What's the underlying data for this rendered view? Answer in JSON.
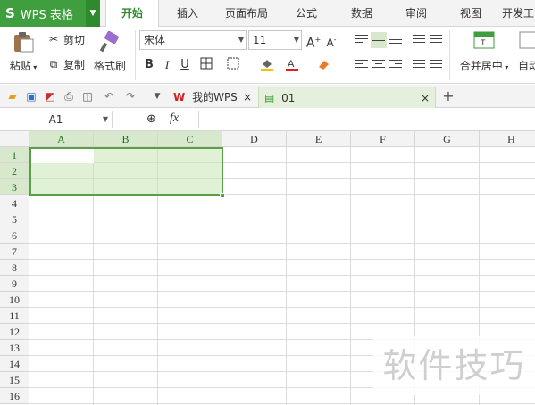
{
  "app": {
    "title": "WPS 表格",
    "logo": "S"
  },
  "menu_tabs": [
    "开始",
    "插入",
    "页面布局",
    "公式",
    "数据",
    "审阅",
    "视图",
    "开发工"
  ],
  "ribbon": {
    "paste_label": "粘贴",
    "cut_label": "剪切",
    "copy_label": "复制",
    "format_painter_label": "格式刷",
    "font_name": "宋体",
    "font_size": "11",
    "bold": "B",
    "italic": "I",
    "underline": "U",
    "merge_center_label": "合并居中",
    "auto_wrap_label": "自动"
  },
  "doc_tabs": [
    {
      "label": "我的WPS"
    },
    {
      "label": "01"
    }
  ],
  "formula_bar": {
    "name_box": "A1",
    "fx": "fx",
    "value": ""
  },
  "columns": [
    "A",
    "B",
    "C",
    "D",
    "E",
    "F",
    "G",
    "H"
  ],
  "rows": [
    "1",
    "2",
    "3",
    "4",
    "5",
    "6",
    "7",
    "8",
    "9",
    "10",
    "11",
    "12",
    "13",
    "14",
    "15",
    "16"
  ],
  "selected_range": "A1:C3",
  "watermark": "软件技巧",
  "colors": {
    "accent": "#3f9e3d",
    "selection_border": "#5a9e48",
    "selection_fill": "#c8e6b4"
  }
}
